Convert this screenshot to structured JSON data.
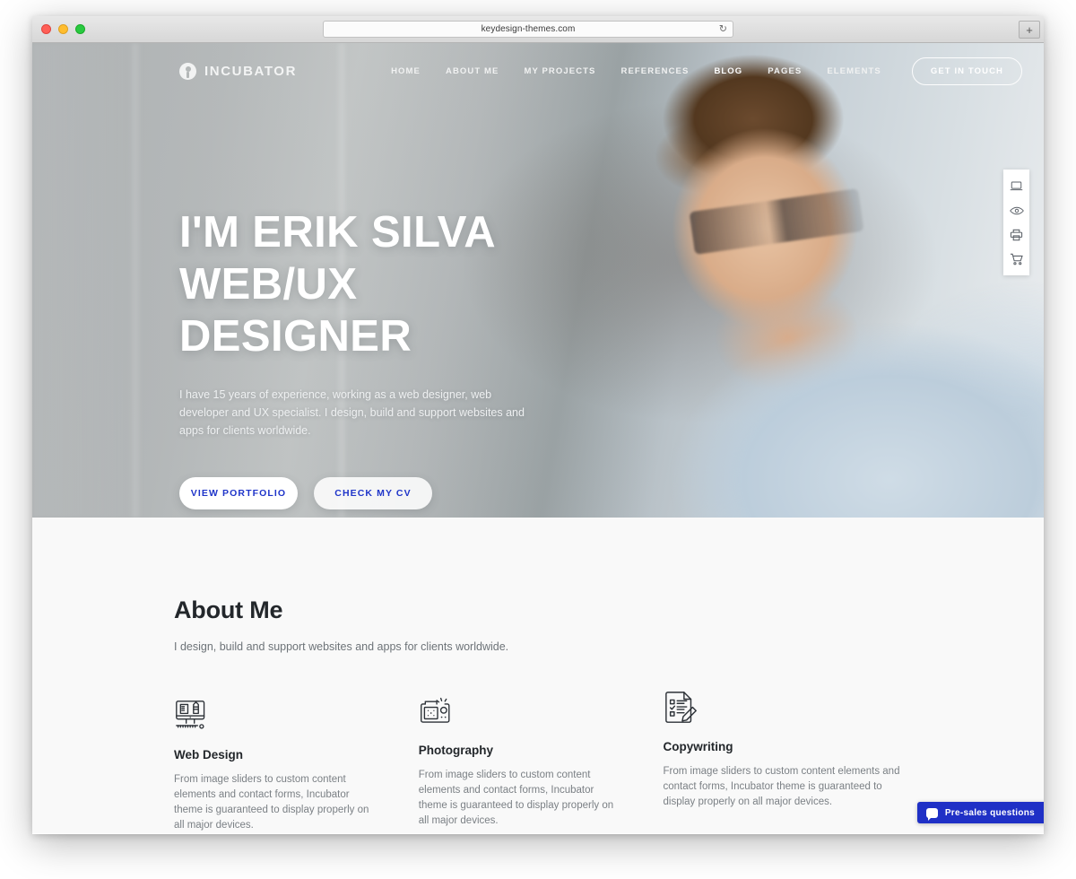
{
  "browser": {
    "url": "keydesign-themes.com",
    "reload_icon": "reload-icon",
    "new_tab_label": "+"
  },
  "header": {
    "brand_name": "INCUBATOR",
    "brand_mark_icon": "incubator-logo-icon",
    "nav_items": [
      {
        "label": "HOME",
        "active": false
      },
      {
        "label": "ABOUT ME",
        "active": false
      },
      {
        "label": "MY PROJECTS",
        "active": false
      },
      {
        "label": "REFERENCES",
        "active": false
      },
      {
        "label": "BLOG",
        "active": true
      },
      {
        "label": "PAGES",
        "active": false
      },
      {
        "label": "ELEMENTS",
        "active": false
      }
    ],
    "cta_label": "GET IN TOUCH"
  },
  "hero": {
    "title_line1": "I'M ERIK SILVA",
    "title_line2": "WEB/UX DESIGNER",
    "subtitle": "I have 15 years of experience, working as a web designer, web developer and UX specialist. I design, build and support websites and apps for clients worldwide.",
    "primary_button": "VIEW PORTFOLIO",
    "secondary_button": "CHECK MY CV",
    "button_text_color": "#1f35c9"
  },
  "side_toolbar": {
    "items": [
      {
        "icon": "laptop-icon"
      },
      {
        "icon": "eye-icon"
      },
      {
        "icon": "printer-icon"
      },
      {
        "icon": "shopping-cart-icon"
      }
    ]
  },
  "about": {
    "title": "About Me",
    "subtitle": "I design, build and support websites and apps for clients worldwide.",
    "features": [
      {
        "icon": "web-design-monitor-ruler-pencil-icon",
        "title": "Web Design",
        "text": "From image sliders to custom content elements and contact forms, Incubator theme is guaranteed to display properly on all major devices."
      },
      {
        "icon": "photography-camera-icon",
        "title": "Photography",
        "text": "From image sliders to custom content elements and contact forms, Incubator theme is guaranteed to display properly on all major devices."
      },
      {
        "icon": "copywriting-document-pencil-icon",
        "title": "Copywriting",
        "text": "From image sliders to custom content elements and contact forms, Incubator theme is guaranteed to display properly on all major devices."
      }
    ]
  },
  "chat_widget": {
    "label": "Pre-sales questions",
    "icon": "chat-bubble-icon",
    "background_color": "#1f30c6"
  }
}
